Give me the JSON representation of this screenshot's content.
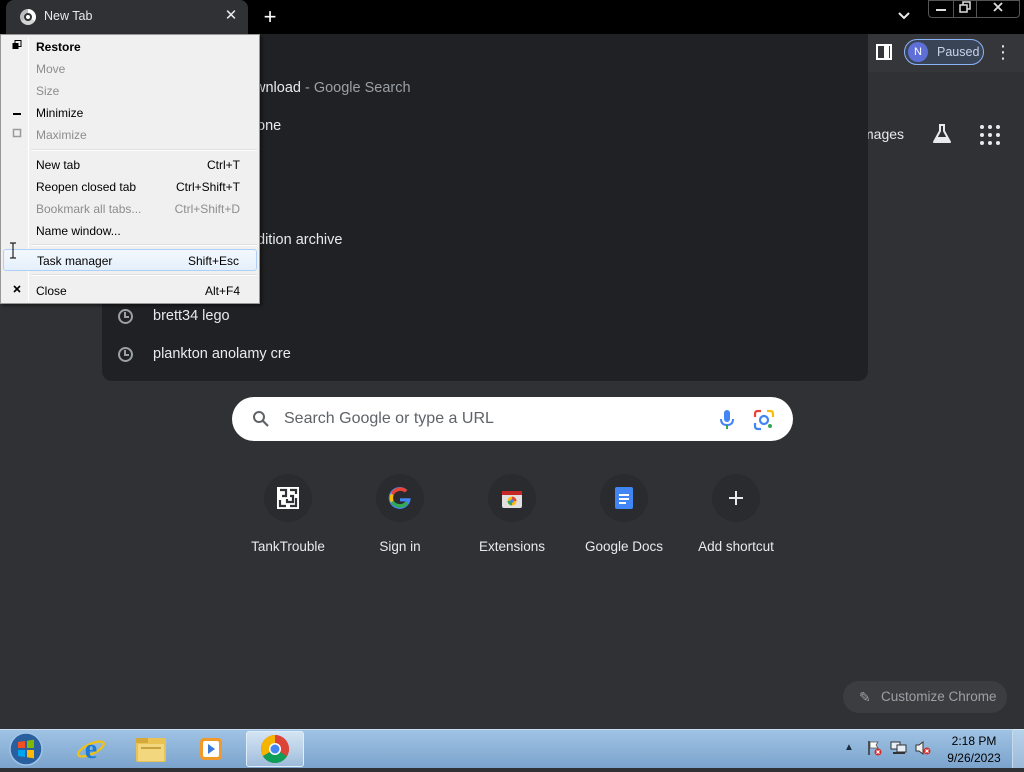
{
  "tab": {
    "title": "New Tab",
    "close": "✕"
  },
  "toolbar": {
    "profile_initial": "N",
    "profile_status": "Paused"
  },
  "page": {
    "images_link": "mages",
    "suggestions": [
      {
        "text": "wnload",
        "suffix": " - Google Search"
      },
      {
        "text": "one",
        "suffix": ""
      },
      {
        "text": "dition archive",
        "suffix": ""
      },
      {
        "text": "brett34 lego",
        "suffix": ""
      },
      {
        "text": "plankton anolamy cre",
        "suffix": ""
      }
    ],
    "search": {
      "placeholder": "Search Google or type a URL"
    },
    "shortcuts": [
      {
        "label": "TankTrouble"
      },
      {
        "label": "Sign in"
      },
      {
        "label": "Extensions"
      },
      {
        "label": "Google Docs"
      },
      {
        "label": "Add shortcut"
      }
    ],
    "customize_label": "Customize Chrome"
  },
  "system_menu": {
    "items": [
      {
        "label": "Restore",
        "accel": "",
        "enabled": true,
        "glyph": "restore"
      },
      {
        "label": "Move",
        "accel": "",
        "enabled": false
      },
      {
        "label": "Size",
        "accel": "",
        "enabled": false
      },
      {
        "label": "Minimize",
        "accel": "",
        "enabled": true,
        "glyph": "minimize"
      },
      {
        "label": "Maximize",
        "accel": "",
        "enabled": false,
        "glyph": "maximize"
      },
      {
        "label": "New tab",
        "accel": "Ctrl+T",
        "enabled": true
      },
      {
        "label": "Reopen closed tab",
        "accel": "Ctrl+Shift+T",
        "enabled": true
      },
      {
        "label": "Bookmark all tabs...",
        "accel": "Ctrl+Shift+D",
        "enabled": false
      },
      {
        "label": "Name window...",
        "accel": "",
        "enabled": true
      },
      {
        "label": "Task manager",
        "accel": "Shift+Esc",
        "enabled": true,
        "highlighted": true
      },
      {
        "label": "Close",
        "accel": "Alt+F4",
        "enabled": true,
        "glyph": "close"
      }
    ]
  },
  "taskbar": {
    "time": "2:18 PM",
    "date": "9/26/2023"
  }
}
